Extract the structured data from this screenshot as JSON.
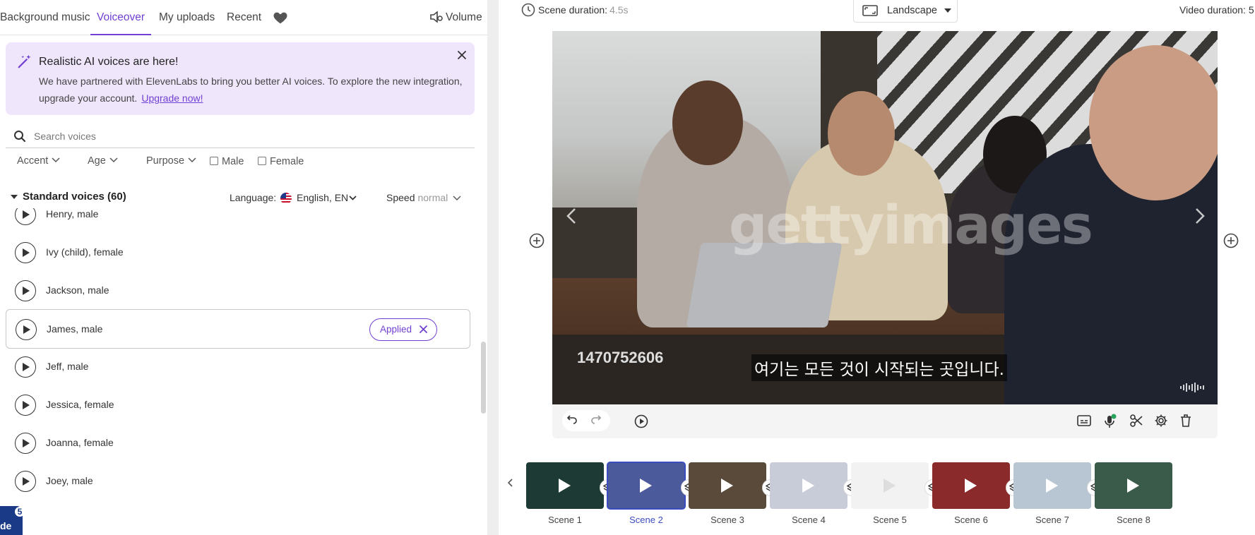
{
  "left": {
    "tabs": [
      {
        "label": "Background music",
        "active": false
      },
      {
        "label": "Voiceover",
        "active": true
      },
      {
        "label": "My uploads",
        "active": false
      },
      {
        "label": "Recent",
        "active": false
      }
    ],
    "favorites_icon": "heart-icon",
    "volume_label": "Volume",
    "banner": {
      "title": "Realistic AI voices are here!",
      "text": "We have partnered with ElevenLabs to bring you better AI voices. To explore the new integration, upgrade your account.",
      "link": "Upgrade now!"
    },
    "search": {
      "placeholder": "Search voices",
      "value": ""
    },
    "filters": {
      "accent": "Accent",
      "age": "Age",
      "purpose": "Purpose",
      "male": "Male",
      "female": "Female"
    },
    "section": {
      "title": "Standard voices (60)",
      "language_label": "Language:",
      "language_value": "English, EN",
      "speed_label": "Speed",
      "speed_value": "normal"
    },
    "voices": [
      {
        "name": "Henry, male",
        "applied": false
      },
      {
        "name": "Ivy (child), female",
        "applied": false
      },
      {
        "name": "Jackson, male",
        "applied": false
      },
      {
        "name": "James, male",
        "applied": true
      },
      {
        "name": "Jeff, male",
        "applied": false
      },
      {
        "name": "Jessica, female",
        "applied": false
      },
      {
        "name": "Joanna, female",
        "applied": false
      },
      {
        "name": "Joey, male",
        "applied": false
      }
    ],
    "applied_label": "Applied",
    "corner_badge": {
      "label": "de",
      "count": "5"
    }
  },
  "right": {
    "scene_duration_label": "Scene duration:",
    "scene_duration_value": "4.5s",
    "orientation": "Landscape",
    "video_duration_label": "Video duration: 5",
    "video": {
      "watermark": "gettyimages",
      "stock_id": "1470752606",
      "subtitle": "여기는 모든 것이 시작되는 곳입니다."
    },
    "scenes": [
      {
        "label": "Scene 1",
        "active": false,
        "color": "#1e3a34"
      },
      {
        "label": "Scene 2",
        "active": true,
        "color": "#4a5a9a"
      },
      {
        "label": "Scene 3",
        "active": false,
        "color": "#5a4a3a"
      },
      {
        "label": "Scene 4",
        "active": false,
        "color": "#c8ccd8"
      },
      {
        "label": "Scene 5",
        "active": false,
        "color": "#f2f2f2"
      },
      {
        "label": "Scene 6",
        "active": false,
        "color": "#8a2a2a"
      },
      {
        "label": "Scene 7",
        "active": false,
        "color": "#b8c6d4"
      },
      {
        "label": "Scene 8",
        "active": false,
        "color": "#3a5a4a"
      }
    ]
  },
  "colors": {
    "accent": "#7140d2",
    "banner_bg": "#efe6fc",
    "scene_active": "#3b4cc0"
  }
}
